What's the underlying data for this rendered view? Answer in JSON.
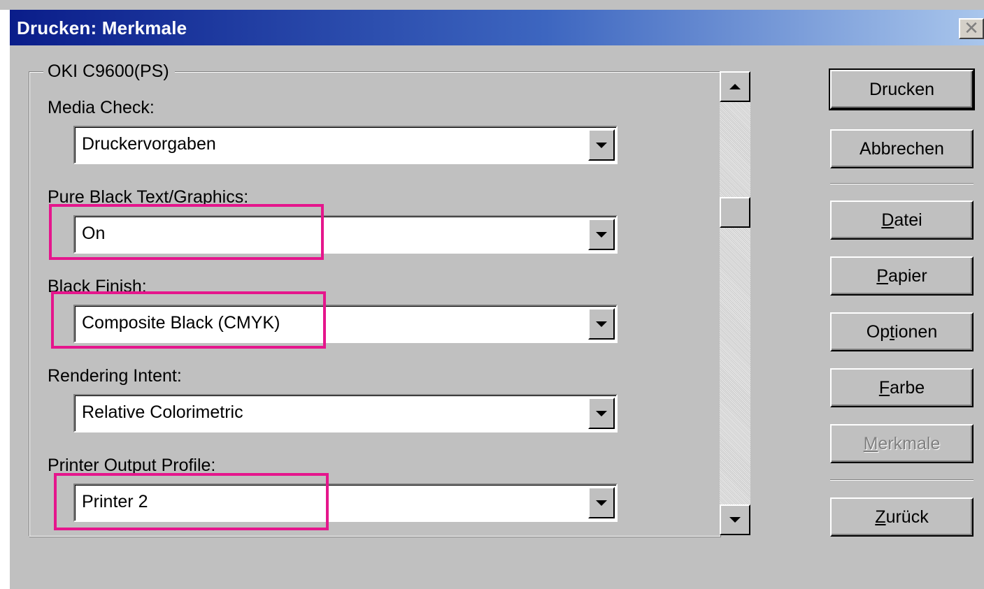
{
  "window": {
    "title": "Drucken: Merkmale",
    "close_label": "✕"
  },
  "group": {
    "label": "OKI C9600(PS)"
  },
  "fields": [
    {
      "label": "Media Check:",
      "value": "Druckervorgaben"
    },
    {
      "label": "Pure Black Text/Graphics:",
      "value": "On"
    },
    {
      "label": "Black Finish:",
      "value": "Composite Black (CMYK)"
    },
    {
      "label": "Rendering Intent:",
      "value": "Relative Colorimetric"
    },
    {
      "label": "Printer Output Profile:",
      "value": "Printer 2"
    }
  ],
  "buttons": {
    "drucken": "Drucken",
    "abbrechen": "Abbrechen",
    "datei": {
      "mnemonic": "D",
      "rest": "atei"
    },
    "papier": {
      "mnemonic": "P",
      "rest": "apier"
    },
    "optionen": {
      "pre": "Op",
      "mnemonic": "t",
      "rest": "ionen"
    },
    "farbe": {
      "mnemonic": "F",
      "rest": "arbe"
    },
    "merkmale": {
      "mnemonic": "M",
      "rest": "erkmale"
    },
    "zurueck": {
      "mnemonic": "Z",
      "rest": "urück"
    }
  },
  "colors": {
    "highlight": "#e5168c",
    "titlebar_start": "#0a1d8a",
    "titlebar_end": "#a9c6ec"
  }
}
